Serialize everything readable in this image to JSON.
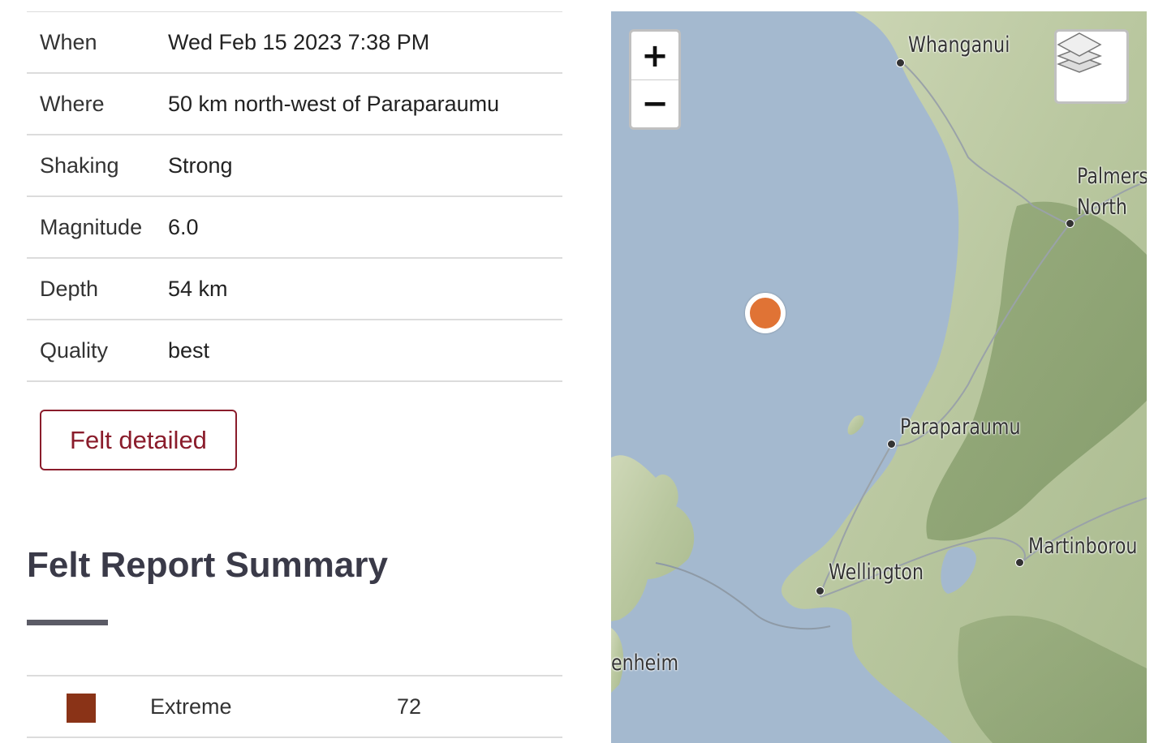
{
  "details": [
    {
      "label": "When",
      "value": "Wed Feb 15 2023 7:38 PM"
    },
    {
      "label": "Where",
      "value": "50 km north-west of Paraparaumu"
    },
    {
      "label": "Shaking",
      "value": "Strong"
    },
    {
      "label": "Magnitude",
      "value": "6.0"
    },
    {
      "label": "Depth",
      "value": "54 km"
    },
    {
      "label": "Quality",
      "value": "best"
    }
  ],
  "felt_button": "Felt detailed",
  "summary": {
    "title": "Felt Report Summary",
    "rows": [
      {
        "label": "Extreme",
        "count": "72",
        "color": "#8a3317"
      }
    ]
  },
  "map": {
    "zoom_in": "+",
    "zoom_out": "−",
    "layers_icon": "layers-icon",
    "marker_color": "#e07335",
    "places": {
      "whanganui": "Whanganui",
      "palmerston_1": "Palmers",
      "palmerston_2": "North",
      "paraparaumu": "Paraparaumu",
      "wellington": "Wellington",
      "martinborough": "Martinborou",
      "blenheim": "enheim"
    }
  }
}
